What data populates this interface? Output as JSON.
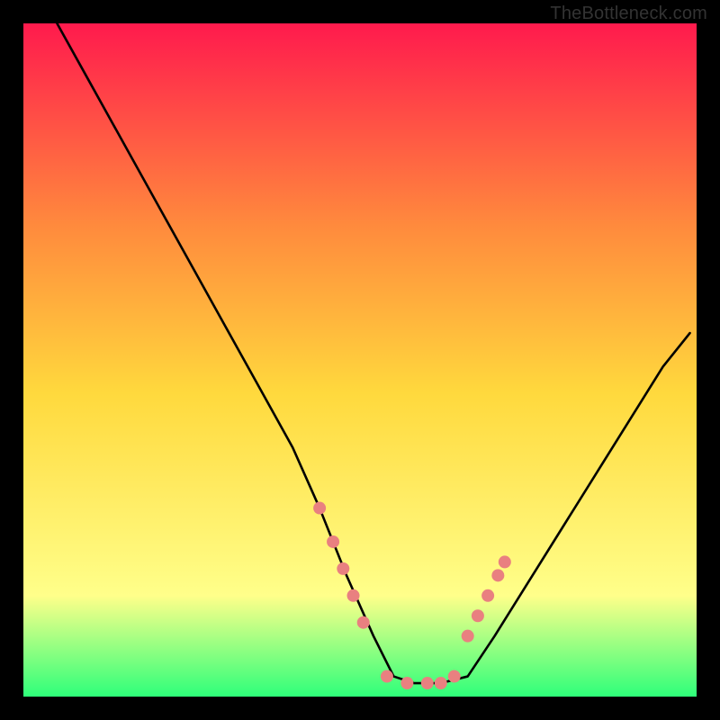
{
  "watermark": "TheBottleneck.com",
  "chart_data": {
    "type": "line",
    "title": "",
    "xlabel": "",
    "ylabel": "",
    "xlim": [
      0,
      100
    ],
    "ylim": [
      0,
      100
    ],
    "grid": false,
    "legend": false,
    "background_gradient": {
      "top": "#ff1a4d",
      "upper_mid": "#ff8a3d",
      "mid": "#ffd93d",
      "lower_mid": "#ffff8a",
      "bottom": "#2eff7a"
    },
    "series": [
      {
        "name": "bottleneck-curve",
        "color": "#000000",
        "x": [
          5,
          10,
          15,
          20,
          25,
          30,
          35,
          40,
          44,
          48,
          52,
          55,
          58,
          62,
          66,
          70,
          75,
          80,
          85,
          90,
          95,
          99
        ],
        "y": [
          100,
          91,
          82,
          73,
          64,
          55,
          46,
          37,
          28,
          18,
          9,
          3,
          2,
          2,
          3,
          9,
          17,
          25,
          33,
          41,
          49,
          54
        ]
      }
    ],
    "markers": {
      "name": "highlight-dots",
      "color": "#e98080",
      "radius": 7,
      "x": [
        44,
        46,
        47.5,
        49,
        50.5,
        54,
        57,
        60,
        62,
        64,
        66,
        67.5,
        69,
        70.5,
        71.5
      ],
      "y": [
        28,
        23,
        19,
        15,
        11,
        3,
        2,
        2,
        2,
        3,
        9,
        12,
        15,
        18,
        20
      ]
    }
  }
}
